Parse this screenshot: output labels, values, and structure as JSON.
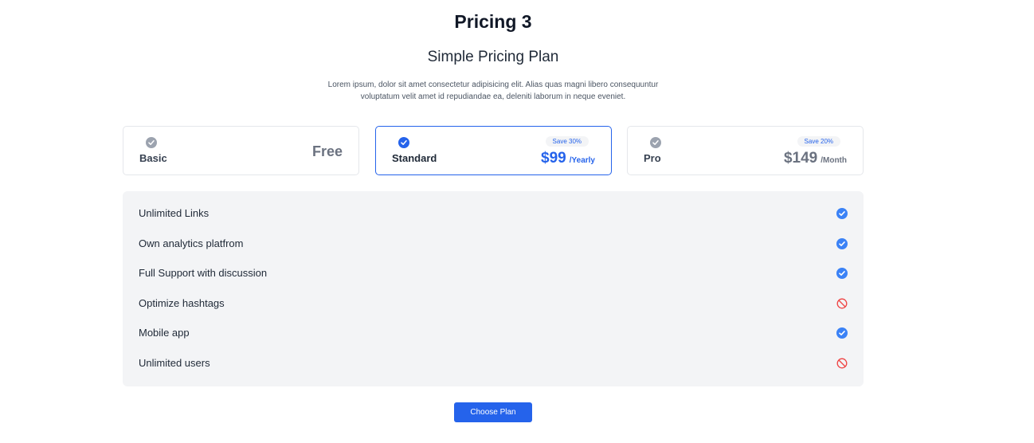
{
  "header": {
    "page_title": "Pricing 3",
    "section_title": "Simple Pricing Plan",
    "description": "Lorem ipsum, dolor sit amet consectetur adipisicing elit. Alias quas magni libero consequuntur voluptatum velit amet id repudiandae ea, deleniti laborum in neque eveniet."
  },
  "plans": [
    {
      "name": "Basic",
      "price_label": "Free",
      "selected": false,
      "icon": "check-circle-icon"
    },
    {
      "name": "Standard",
      "badge": "Save 30%",
      "price": "$99",
      "period": "/Yearly",
      "selected": true,
      "icon": "check-circle-icon"
    },
    {
      "name": "Pro",
      "badge": "Save 20%",
      "price": "$149",
      "period": "/Month",
      "selected": false,
      "icon": "check-circle-icon"
    }
  ],
  "features": [
    {
      "label": "Unlimited Links",
      "included": true,
      "icon": "check-circle-icon"
    },
    {
      "label": "Own analytics platfrom",
      "included": true,
      "icon": "check-circle-icon"
    },
    {
      "label": "Full Support with discussion",
      "included": true,
      "icon": "check-circle-icon"
    },
    {
      "label": "Optimize hashtags",
      "included": false,
      "icon": "ban-icon"
    },
    {
      "label": "Mobile app",
      "included": true,
      "icon": "check-circle-icon"
    },
    {
      "label": "Unlimited users",
      "included": false,
      "icon": "ban-icon"
    }
  ],
  "cta": {
    "label": "Choose Plan"
  },
  "colors": {
    "accent": "#2563eb",
    "included": "#3b82f6",
    "excluded": "#ef4444",
    "muted": "#9ca3af",
    "panel": "#f3f4f6"
  }
}
